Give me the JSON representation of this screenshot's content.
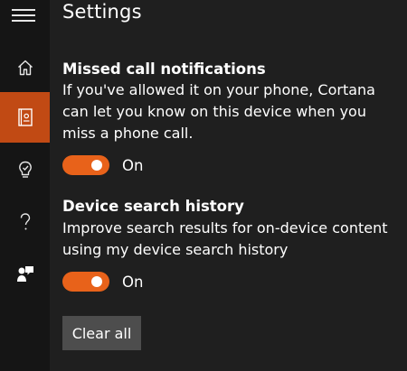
{
  "window": {
    "title": "Settings"
  },
  "sidebar": {
    "items": [
      {
        "icon": "home-icon",
        "active": false
      },
      {
        "icon": "notebook-icon",
        "active": true
      },
      {
        "icon": "reminders-icon",
        "active": false
      },
      {
        "icon": "help-icon",
        "active": false
      },
      {
        "icon": "feedback-icon",
        "active": false
      }
    ]
  },
  "sections": {
    "missed_call": {
      "heading": "Missed call notifications",
      "description": "If you've allowed it on your phone, Cortana can let you know on this device when you miss a phone call.",
      "toggle_state": "On"
    },
    "search_history": {
      "heading": "Device search history",
      "description": "Improve search results for on-device content using my device search history",
      "toggle_state": "On"
    }
  },
  "buttons": {
    "clear_all": "Clear all"
  },
  "colors": {
    "accent": "#e8621a",
    "active_nav": "#c14a14",
    "background": "#1f1f1f",
    "sidebar": "#151515",
    "button": "#4d4d4d"
  }
}
